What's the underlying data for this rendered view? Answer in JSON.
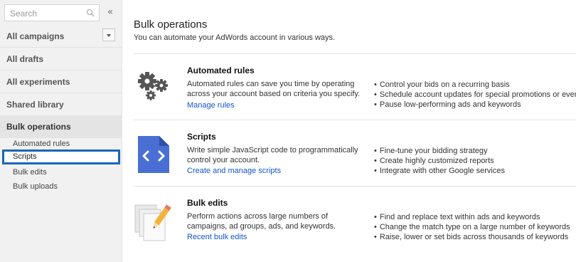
{
  "sidebar": {
    "search_placeholder": "Search",
    "collapse_glyph": "«",
    "items": [
      {
        "label": "All campaigns"
      },
      {
        "label": "All drafts"
      },
      {
        "label": "All experiments"
      },
      {
        "label": "Shared library"
      },
      {
        "label": "Bulk operations"
      }
    ],
    "sub_items": [
      {
        "label": "Automated rules"
      },
      {
        "label": "Scripts"
      },
      {
        "label": "Bulk edits"
      },
      {
        "label": "Bulk uploads"
      }
    ]
  },
  "main": {
    "title": "Bulk operations",
    "subtitle": "You can automate your AdWords account in various ways.",
    "sections": [
      {
        "title": "Automated rules",
        "description": "Automated rules can save you time by operating across your account based on criteria you specify.",
        "link": "Manage rules",
        "icon": "gears-icon",
        "bullets": [
          "Control your bids on a recurring basis",
          "Schedule account updates for special promotions or events",
          "Pause low-performing ads and keywords"
        ]
      },
      {
        "title": "Scripts",
        "description": "Write simple JavaScript code to programmatically control your account.",
        "link": "Create and manage scripts",
        "icon": "code-file-icon",
        "bullets": [
          "Fine-tune your bidding strategy",
          "Create highly customized reports",
          "Integrate with other Google services"
        ]
      },
      {
        "title": "Bulk edits",
        "description": "Perform actions across large numbers of campaigns, ad groups, ads, and keywords.",
        "link": "Recent bulk edits",
        "icon": "pencil-pages-icon",
        "bullets": [
          "Find and replace text within ads and keywords",
          "Change the match type on a large number of keywords",
          "Raise, lower or set bids across thousands of keywords"
        ]
      }
    ]
  },
  "colors": {
    "link": "#1155cc",
    "selection_border": "#1a66b7",
    "script_icon": "#4a6fd4",
    "sidebar_bg": "#f1f1f1"
  }
}
